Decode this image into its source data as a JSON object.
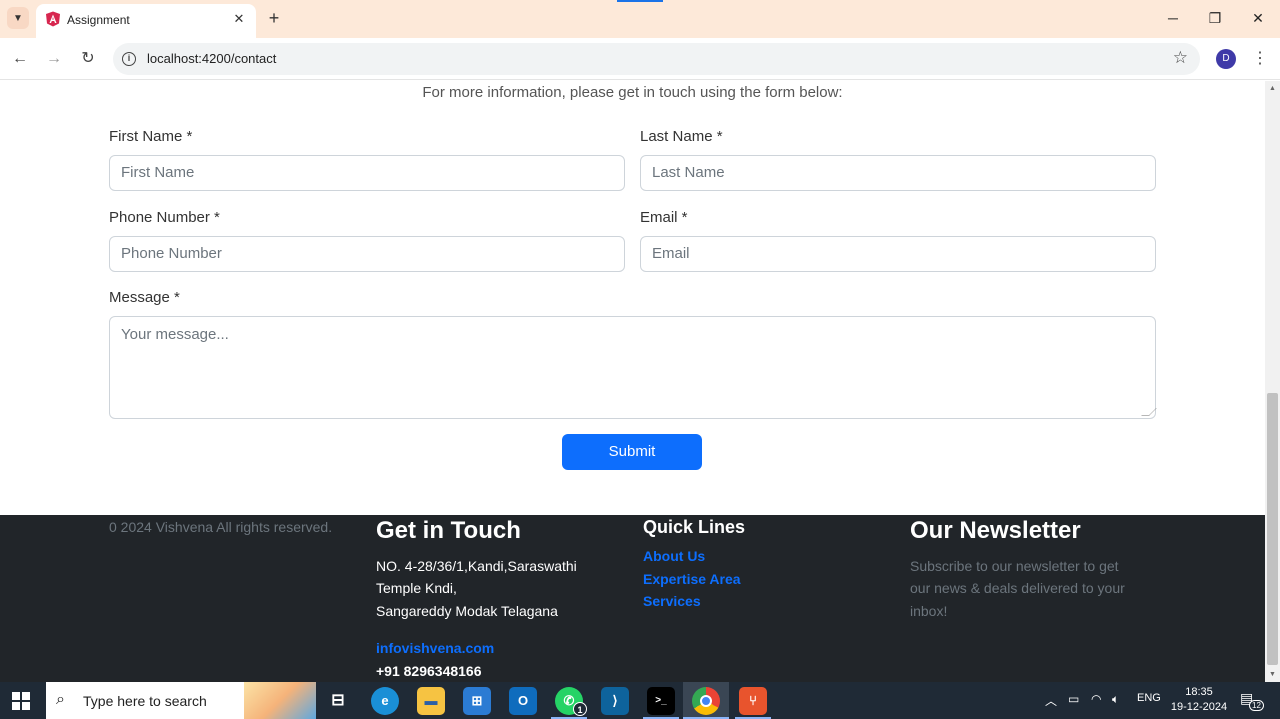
{
  "browser": {
    "tab_title": "Assignment",
    "url": "localhost:4200/contact",
    "profile_initial": "D"
  },
  "page": {
    "intro": "For more information, please get in touch using the form below:",
    "form": {
      "first_name_label": "First Name *",
      "first_name_placeholder": "First Name",
      "last_name_label": "Last Name *",
      "last_name_placeholder": "Last Name",
      "phone_label": "Phone Number *",
      "phone_placeholder": "Phone Number",
      "email_label": "Email *",
      "email_placeholder": "Email",
      "message_label": "Message *",
      "message_placeholder": "Your message...",
      "submit_label": "Submit"
    },
    "footer": {
      "copyright": "0 2024 Vishvena All rights reserved.",
      "get_in_touch": {
        "heading": "Get in Touch",
        "address_line1": "NO. 4-28/36/1,Kandi,Saraswathi",
        "address_line2": "Temple Kndi,",
        "address_line3": "Sangareddy Modak Telagana",
        "email": "infovishvena.com",
        "phone": "+91 8296348166"
      },
      "quick_links": {
        "heading": "Quick Lines",
        "items": [
          "About Us",
          "Expertise Area",
          "Services"
        ]
      },
      "newsletter": {
        "heading": "Our Newsletter",
        "line1": "Subscribe to our newsletter to get",
        "line2": "our news & deals delivered to your",
        "line3": "inbox!"
      }
    }
  },
  "taskbar": {
    "search_placeholder": "Type here to search",
    "whatsapp_badge": "1",
    "language": "ENG",
    "time": "18:35",
    "date": "19-12-2024",
    "notification_count": "12"
  },
  "colors": {
    "primary": "#0d6efd",
    "footer_bg": "#212529",
    "tabbar_bg": "#fde9d9"
  }
}
